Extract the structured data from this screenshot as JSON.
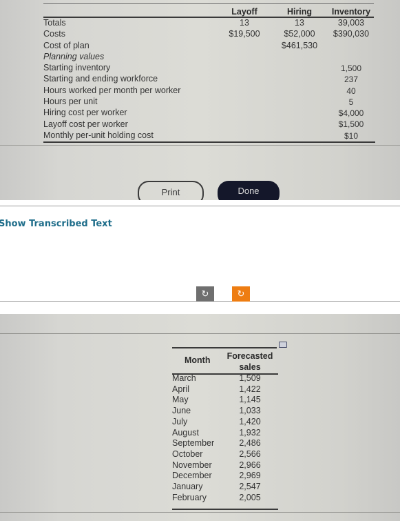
{
  "plan_table": {
    "columns": [
      "Layoff",
      "Hiring",
      "Inventory"
    ],
    "row_labels": [
      {
        "label": "Totals",
        "italic": false
      },
      {
        "label": "Costs",
        "italic": false
      },
      {
        "label": "Cost of plan",
        "italic": false
      },
      {
        "label": "Planning values",
        "italic": true
      },
      {
        "label": "Starting inventory",
        "italic": false
      },
      {
        "label": "Starting and ending workforce",
        "italic": false
      },
      {
        "label": "Hours worked per month per worker",
        "italic": false
      },
      {
        "label": "Hours per unit",
        "italic": false
      },
      {
        "label": "Hiring cost per worker",
        "italic": false
      },
      {
        "label": "Layoff cost per worker",
        "italic": false
      },
      {
        "label": "Monthly per-unit holding cost",
        "italic": false
      }
    ],
    "totals": {
      "layoff": "13",
      "hiring": "13",
      "inventory": "39,003"
    },
    "costs": {
      "layoff": "$19,500",
      "hiring": "$52,000",
      "inventory": "$390,030"
    },
    "cost_of_plan": "$461,530",
    "planning_values": [
      {
        "name": "Starting inventory",
        "value": "1,500"
      },
      {
        "name": "Starting and ending workforce",
        "value": "237"
      },
      {
        "name": "Hours worked per month per worker",
        "value": "40"
      },
      {
        "name": "Hours per unit",
        "value": "5"
      },
      {
        "name": "Hiring cost per worker",
        "value": "$4,000"
      },
      {
        "name": "Layoff cost per worker",
        "value": "$1,500"
      },
      {
        "name": "Monthly per-unit holding cost",
        "value": "$10"
      }
    ]
  },
  "buttons": {
    "print": "Print",
    "done": "Done"
  },
  "show_transcribed": "Show Transcribed Text",
  "rotate_controls": {
    "left_icon": "rotate-left-icon",
    "right_icon": "rotate-right-icon",
    "left_glyph": "↻",
    "right_glyph": "↻",
    "left_color": "#6f6f6f",
    "right_color": "#ee7d12"
  },
  "forecast_table": {
    "headers": {
      "month": "Month",
      "sales_line1": "Forecasted",
      "sales_line2": "sales"
    },
    "rows": [
      {
        "month": "March",
        "sales": "1,509"
      },
      {
        "month": "April",
        "sales": "1,422"
      },
      {
        "month": "May",
        "sales": "1,145"
      },
      {
        "month": "June",
        "sales": "1,033"
      },
      {
        "month": "July",
        "sales": "1,420"
      },
      {
        "month": "August",
        "sales": "1,932"
      },
      {
        "month": "September",
        "sales": "2,486"
      },
      {
        "month": "October",
        "sales": "2,566"
      },
      {
        "month": "November",
        "sales": "2,966"
      },
      {
        "month": "December",
        "sales": "2,969"
      },
      {
        "month": "January",
        "sales": "2,547"
      },
      {
        "month": "February",
        "sales": "2,005"
      }
    ]
  },
  "colors": {
    "link": "#1e6d8a",
    "accent": "#ee7d12",
    "done_button": "#14172a"
  }
}
